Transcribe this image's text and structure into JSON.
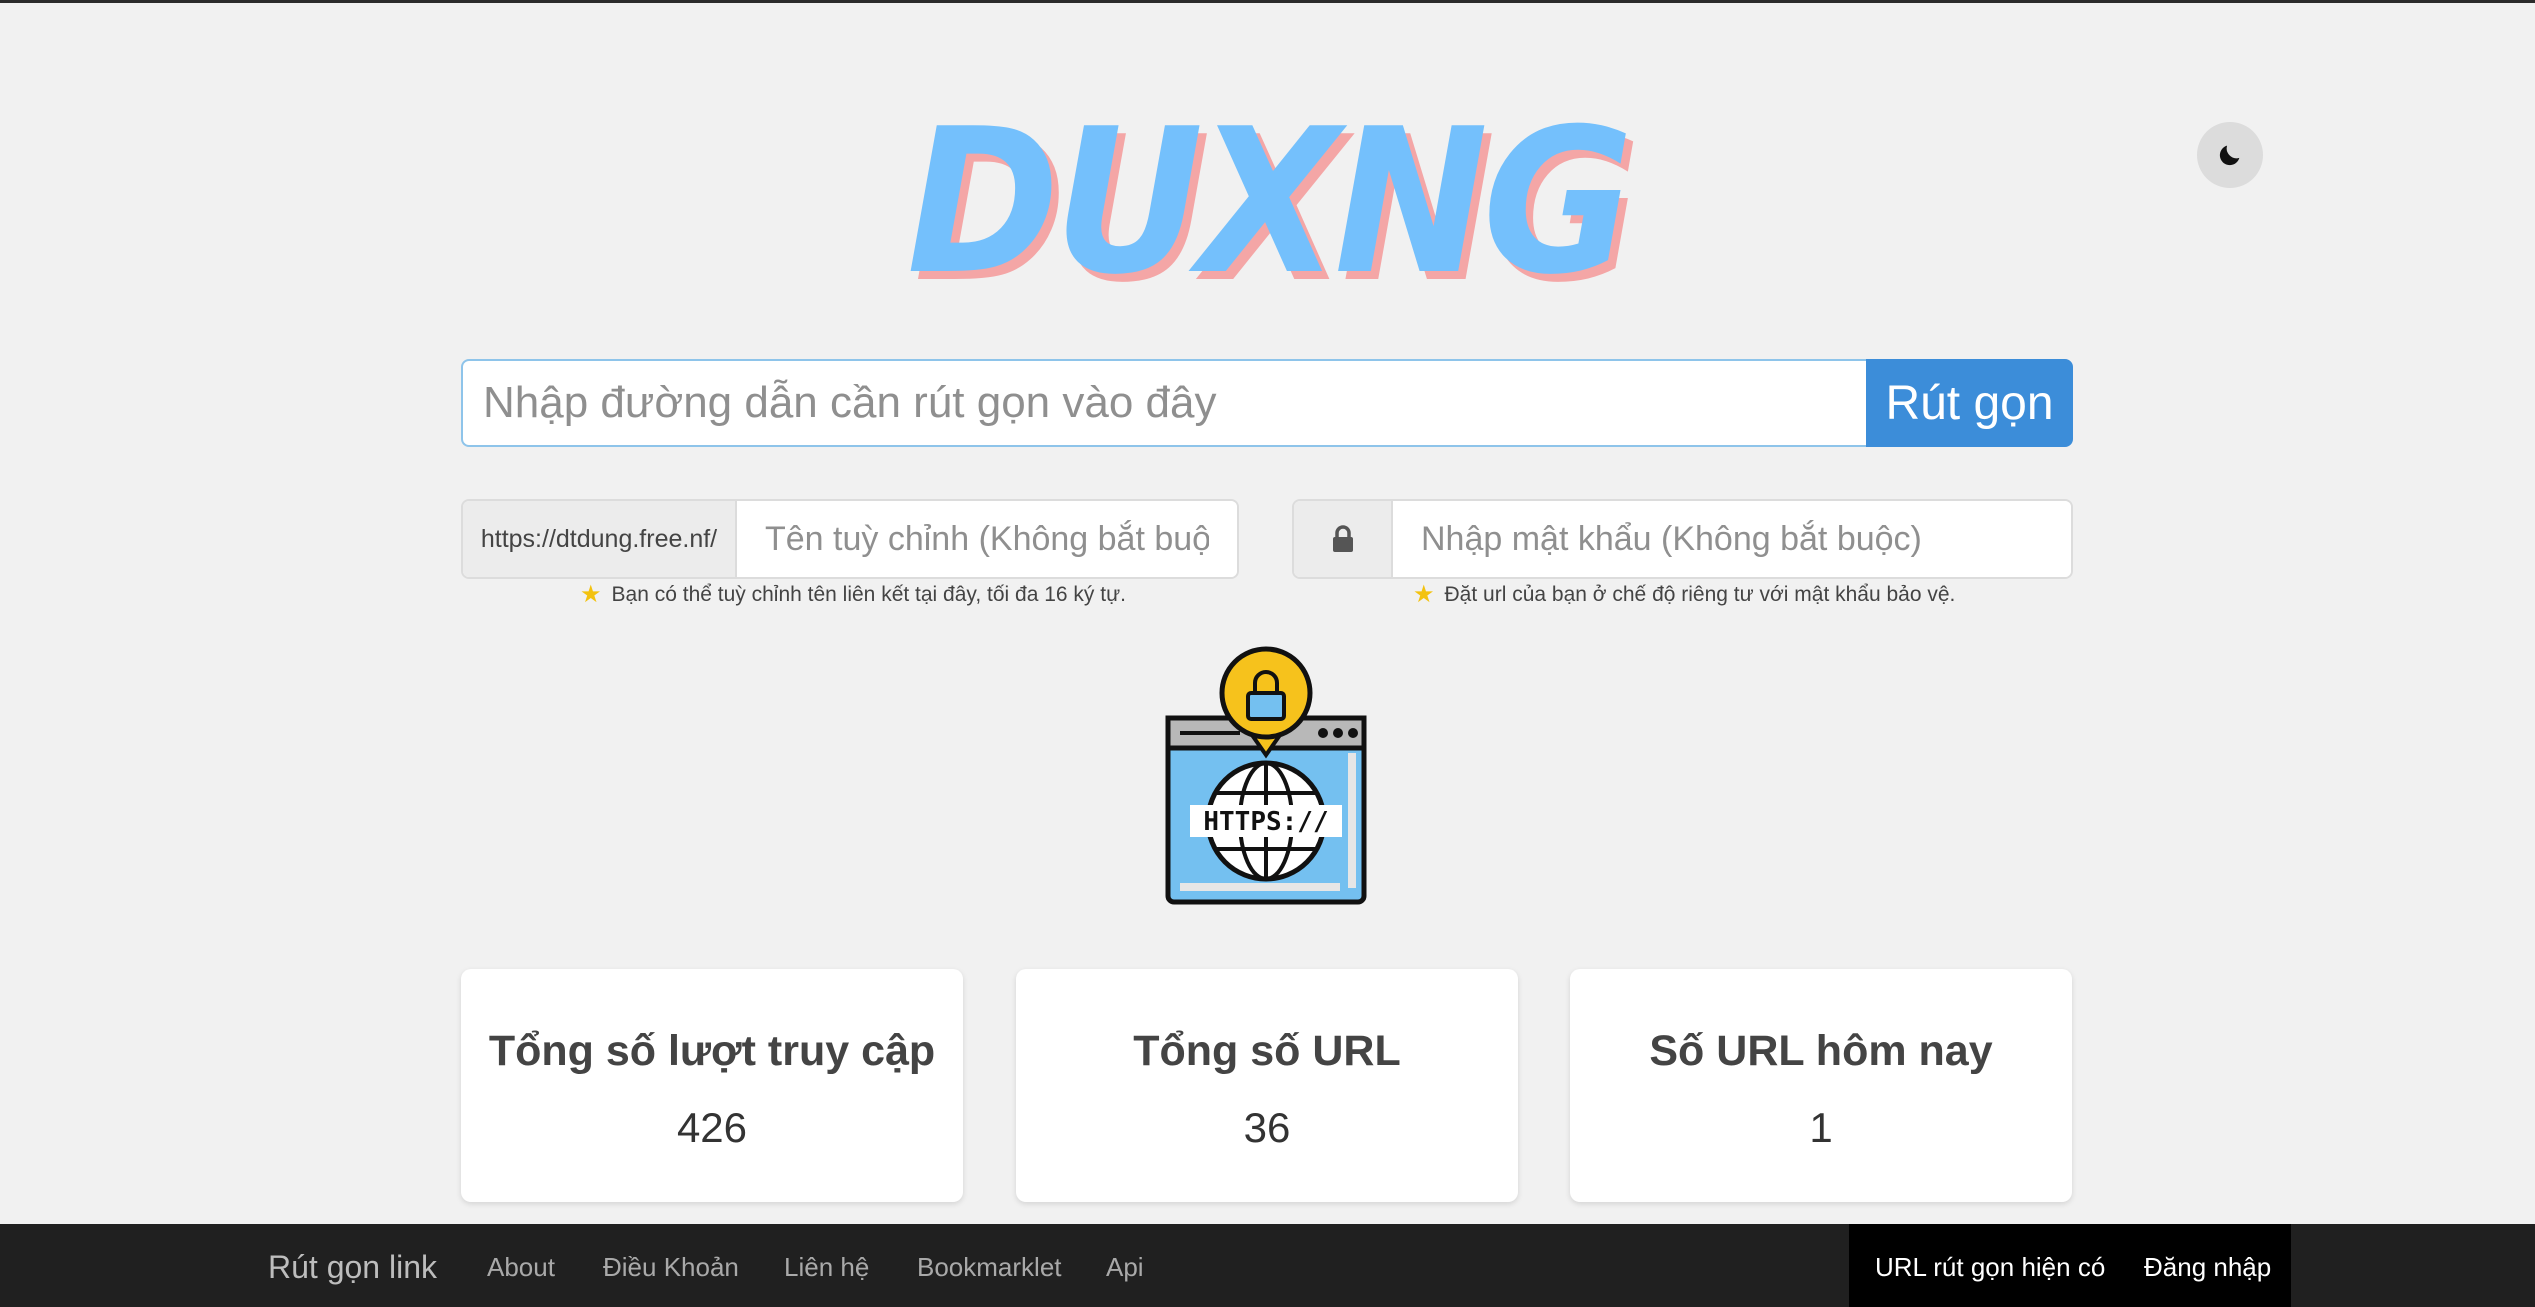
{
  "logo": {
    "text": "DUXNG"
  },
  "theme_toggle": {
    "icon": "moon-icon"
  },
  "search": {
    "placeholder": "Nhập đường dẫn cần rút gọn vào đây",
    "value": "",
    "button_label": "Rút gọn"
  },
  "custom_alias": {
    "prefix": "https://dtdung.free.nf/",
    "placeholder": "Tên tuỳ chỉnh (Không bắt buộc)",
    "hint": "Bạn có thể tuỳ chỉnh tên liên kết tại đây, tối đa 16 ký tự."
  },
  "password": {
    "icon": "lock-icon",
    "placeholder": "Nhập mật khẩu (Không bắt buộc)",
    "hint": "Đặt url của bạn ở chế độ riêng tư với mật khẩu bảo vệ."
  },
  "illustration": {
    "text": "HTTPS://"
  },
  "stats": [
    {
      "title": "Tổng số lượt truy cập",
      "value": "426"
    },
    {
      "title": "Tổng số URL",
      "value": "36"
    },
    {
      "title": "Số URL hôm nay",
      "value": "1"
    }
  ],
  "footer": {
    "brand": "Rút gọn link",
    "nav": [
      "About",
      "Điều Khoản",
      "Liên hệ",
      "Bookmarklet",
      "Api"
    ],
    "right": [
      "URL rút gọn hiện có",
      "Đăng nhập"
    ]
  },
  "colors": {
    "accent": "#3c8dd9",
    "logo": "#74c0fc",
    "logo_shadow": "#f4a6a6",
    "footer_bg": "#202020"
  }
}
